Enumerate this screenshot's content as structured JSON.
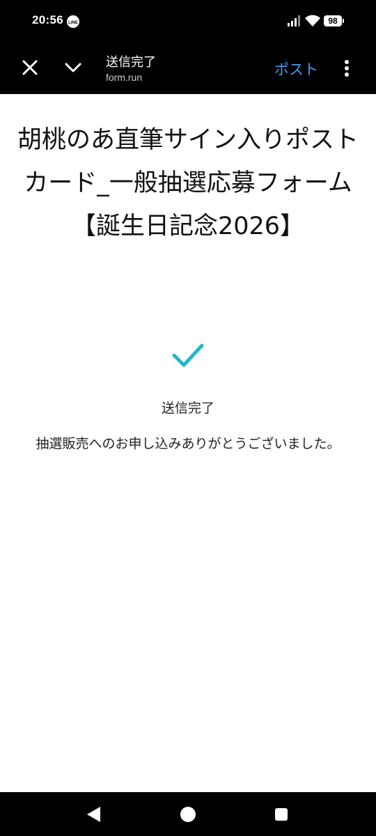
{
  "status_bar": {
    "time": "20:56",
    "notification_icon": "line-app-icon",
    "battery_level": "98"
  },
  "toolbar": {
    "title": "送信完了",
    "url": "form.run",
    "post_label": "ポスト",
    "link_color": "#4a9bf0"
  },
  "form": {
    "title": "胡桃のあ直筆サイン入りポストカード_一般抽選応募フォーム【誕生日記念2026】",
    "check_color": "#1fb8c8",
    "done_heading": "送信完了",
    "done_message": "抽選販売へのお申し込みありがとうございました。"
  },
  "nav": {
    "back_icon": "triangle-back-icon",
    "home_icon": "circle-home-icon",
    "recent_icon": "square-recents-icon"
  }
}
